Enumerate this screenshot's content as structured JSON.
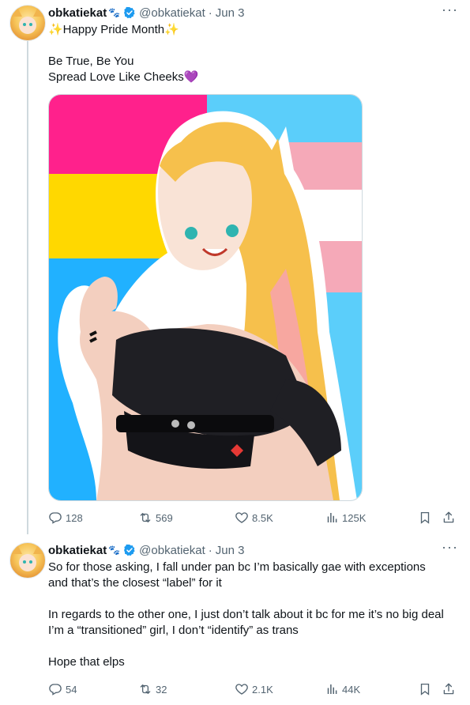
{
  "colors": {
    "verified": "#1d9bf0",
    "muted": "#536471",
    "text": "#0f1419"
  },
  "tweets": [
    {
      "name": "obkatiekat",
      "badge_emoji": "🐾",
      "handle": "@obkatiekat",
      "separator": "·",
      "date": "Jun 3",
      "more": "···",
      "text": "✨Happy Pride Month✨\n\nBe True, Be You\nSpread Love Like Cheeks💜",
      "has_media": true,
      "stats": {
        "replies": "128",
        "retweets": "569",
        "likes": "8.5K",
        "views": "125K"
      }
    },
    {
      "name": "obkatiekat",
      "badge_emoji": "🐾",
      "handle": "@obkatiekat",
      "separator": "·",
      "date": "Jun 3",
      "more": "···",
      "text": "So for those asking, I fall under pan bc I’m basically gae with exceptions\nand that’s the closest “label” for it\n\nIn regards to the other one, I just don’t talk about it bc for me it’s no big deal\nI’m a “transitioned” girl, I don’t “identify” as trans\n\nHope that elps",
      "has_media": false,
      "stats": {
        "replies": "54",
        "retweets": "32",
        "likes": "2.1K",
        "views": "44K"
      }
    }
  ]
}
